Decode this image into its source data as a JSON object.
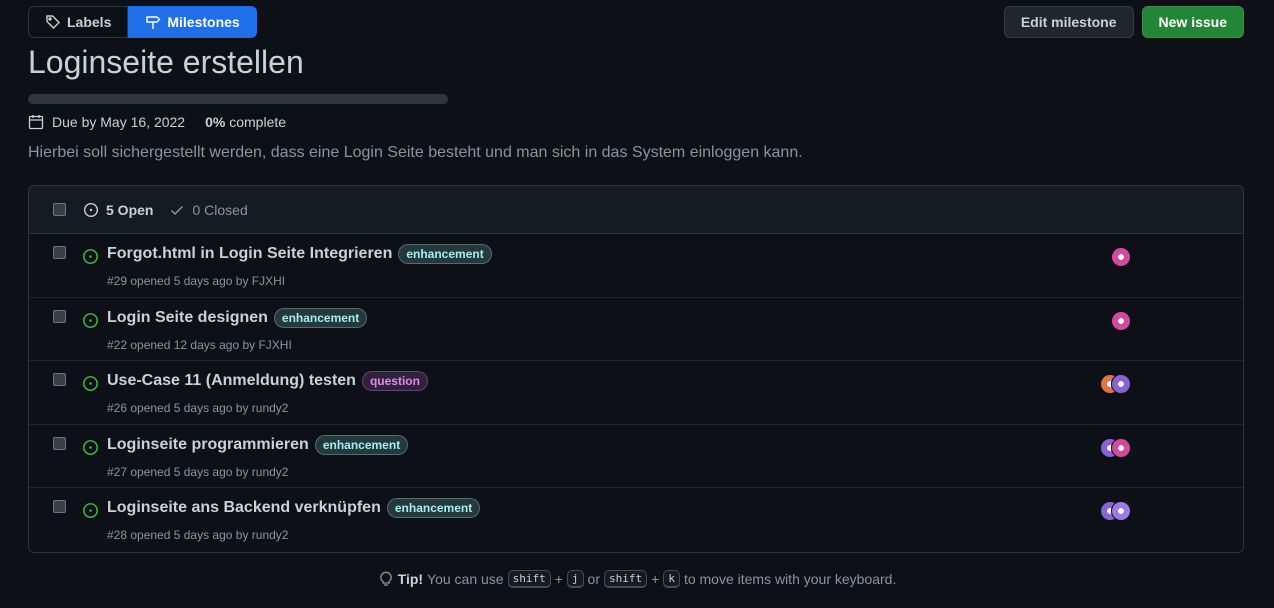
{
  "nav": {
    "labels": "Labels",
    "milestones": "Milestones"
  },
  "actions": {
    "edit": "Edit milestone",
    "new_issue": "New issue"
  },
  "milestone": {
    "title": "Loginseite erstellen",
    "due": "Due by May 16, 2022",
    "percent": "0%",
    "complete": "complete",
    "progress_fraction": 0,
    "description": "Hierbei soll sichergestellt werden, dass eine Login Seite besteht und man sich in das System einloggen kann."
  },
  "states": {
    "open": "5 Open",
    "closed": "0 Closed"
  },
  "issues": [
    {
      "title": "Forgot.html in Login Seite Integrieren",
      "label": "enhancement",
      "label_type": "enhancement",
      "meta": "#29 opened 5 days ago by FJXHI",
      "avatars": [
        "pink"
      ]
    },
    {
      "title": "Login Seite designen",
      "label": "enhancement",
      "label_type": "enhancement",
      "meta": "#22 opened 12 days ago by FJXHI",
      "avatars": [
        "pink"
      ]
    },
    {
      "title": "Use-Case 11 (Anmeldung) testen",
      "label": "question",
      "label_type": "question",
      "meta": "#26 opened 5 days ago by rundy2",
      "avatars": [
        "orange",
        "purple"
      ]
    },
    {
      "title": "Loginseite programmieren",
      "label": "enhancement",
      "label_type": "enhancement",
      "meta": "#27 opened 5 days ago by rundy2",
      "avatars": [
        "purple",
        "pink"
      ]
    },
    {
      "title": "Loginseite ans Backend verknüpfen",
      "label": "enhancement",
      "label_type": "enhancement",
      "meta": "#28 opened 5 days ago by rundy2",
      "avatars": [
        "purple",
        "violet"
      ]
    }
  ],
  "tip": {
    "prefix": "Tip!",
    "text1": "You can use",
    "key1": "shift",
    "plus1": "+",
    "key2": "j",
    "or": "or",
    "key3": "shift",
    "plus2": "+",
    "key4": "k",
    "text2": "to move items with your keyboard."
  },
  "colors": {
    "accent": "#1f6feb",
    "primary": "#238636",
    "open_icon": "#3fb950",
    "avatar_pink": "#d24a9a",
    "avatar_purple": "#8a63d2",
    "avatar_orange": "#e0734a",
    "avatar_violet": "#9b7bea"
  }
}
